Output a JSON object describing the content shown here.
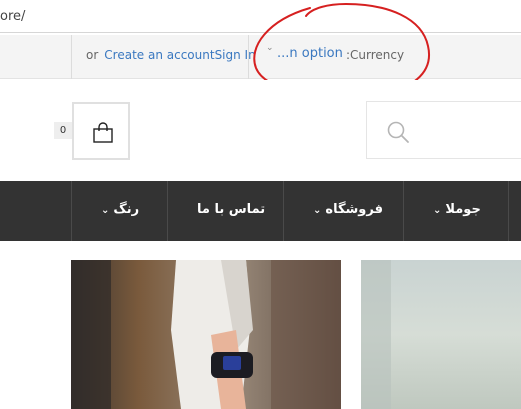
{
  "browser": {
    "url_fragment": "ore/"
  },
  "topbar": {
    "or_text": "or",
    "create_account": "Create an account",
    "sign_in": "Sign In",
    "currency_value": "...n option",
    "currency_label": ":Currency"
  },
  "header": {
    "cart_count": "0"
  },
  "nav": {
    "items": [
      {
        "label": "جوملا"
      },
      {
        "label": "فروشگاه"
      },
      {
        "label": "تماس با ما"
      },
      {
        "label": "رنگ"
      }
    ]
  },
  "colors": {
    "accent_link": "#3a78c0",
    "nav_bg": "#333333",
    "annotation": "#d62020"
  },
  "icons": [
    "shopping-bag-icon",
    "search-icon",
    "chevron-down-icon"
  ]
}
